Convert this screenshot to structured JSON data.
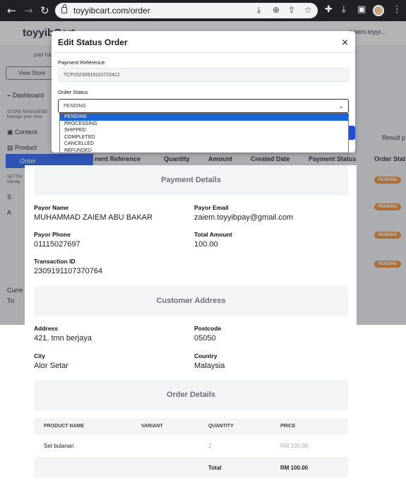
{
  "browser": {
    "url": "toyyibcart.com/order",
    "icons": [
      "back-icon",
      "forward-icon",
      "reload-icon",
      "lock-icon",
      "install-icon",
      "zoom-icon",
      "share-icon",
      "star-icon",
      "extensions-icon",
      "download-icon",
      "sidepanel-icon",
      "profile-avatar",
      "menu-icon"
    ]
  },
  "app": {
    "logo": "toyyibCart",
    "user": "zaiem.toyyi...",
    "store": "pad ha",
    "view_store": "View Store",
    "sidebar": {
      "dashboard": "Dashboard",
      "store_mgmt": "STORE MANAGEME",
      "store_mgmt_sub": "Manage your store",
      "content": "Content",
      "product": "Product",
      "order": "Order",
      "settings": "SETTIN",
      "settings_sub": "Manag",
      "s_item": "S",
      "a_item": "A",
      "current": "Curre",
      "trial": "Tri"
    },
    "table_headers": [
      "nent Reference",
      "Quantity",
      "Amount",
      "Created Date",
      "Payment Status",
      "Order Stat"
    ],
    "result_text": "Result p",
    "badges": [
      "PENDING",
      "PENDING",
      "PENDING",
      "PENDING"
    ],
    "colors": {
      "accent": "#2563eb",
      "badge": "#ea8a2d"
    }
  },
  "modal": {
    "title": "Edit Status Order",
    "close": "×",
    "payment_ref_label": "Payment Reference",
    "payment_ref_value": "TCP20230919110722412",
    "order_status_label": "Order Status",
    "order_status_value": "PENDING",
    "options": [
      "PENDING",
      "PROCESSING",
      "SHIPPED",
      "COMPLETED",
      "CANCELLED",
      "REFUNDED"
    ]
  },
  "payment_details": {
    "title": "Payment Details",
    "payor_name_label": "Payor Name",
    "payor_name": "MUHAMMAD ZAIEM ABU BAKAR",
    "payor_email_label": "Payor Email",
    "payor_email": "zaiem.toyyibpay@gmail.com",
    "payor_phone_label": "Payor Phone",
    "payor_phone": "01115027697",
    "total_amount_label": "Total Amount",
    "total_amount": "100.00",
    "transaction_id_label": "Transaction ID",
    "transaction_id": "2309191107370764"
  },
  "customer_address": {
    "title": "Customer Address",
    "address_label": "Address",
    "address": "421, tmn berjaya",
    "postcode_label": "Postcode",
    "postcode": "05050",
    "city_label": "City",
    "city": "Alor Setar",
    "country_label": "Country",
    "country": "Malaysia"
  },
  "order_details": {
    "title": "Order Details",
    "columns": [
      "PRODUCT NAME",
      "VARIANT",
      "QUANTITY",
      "PRICE"
    ],
    "rows": [
      {
        "product": "Set bulanan",
        "variant": "",
        "quantity": "2",
        "price": "RM 100.00"
      }
    ],
    "total_label": "Total",
    "total_value": "RM 100.00"
  }
}
